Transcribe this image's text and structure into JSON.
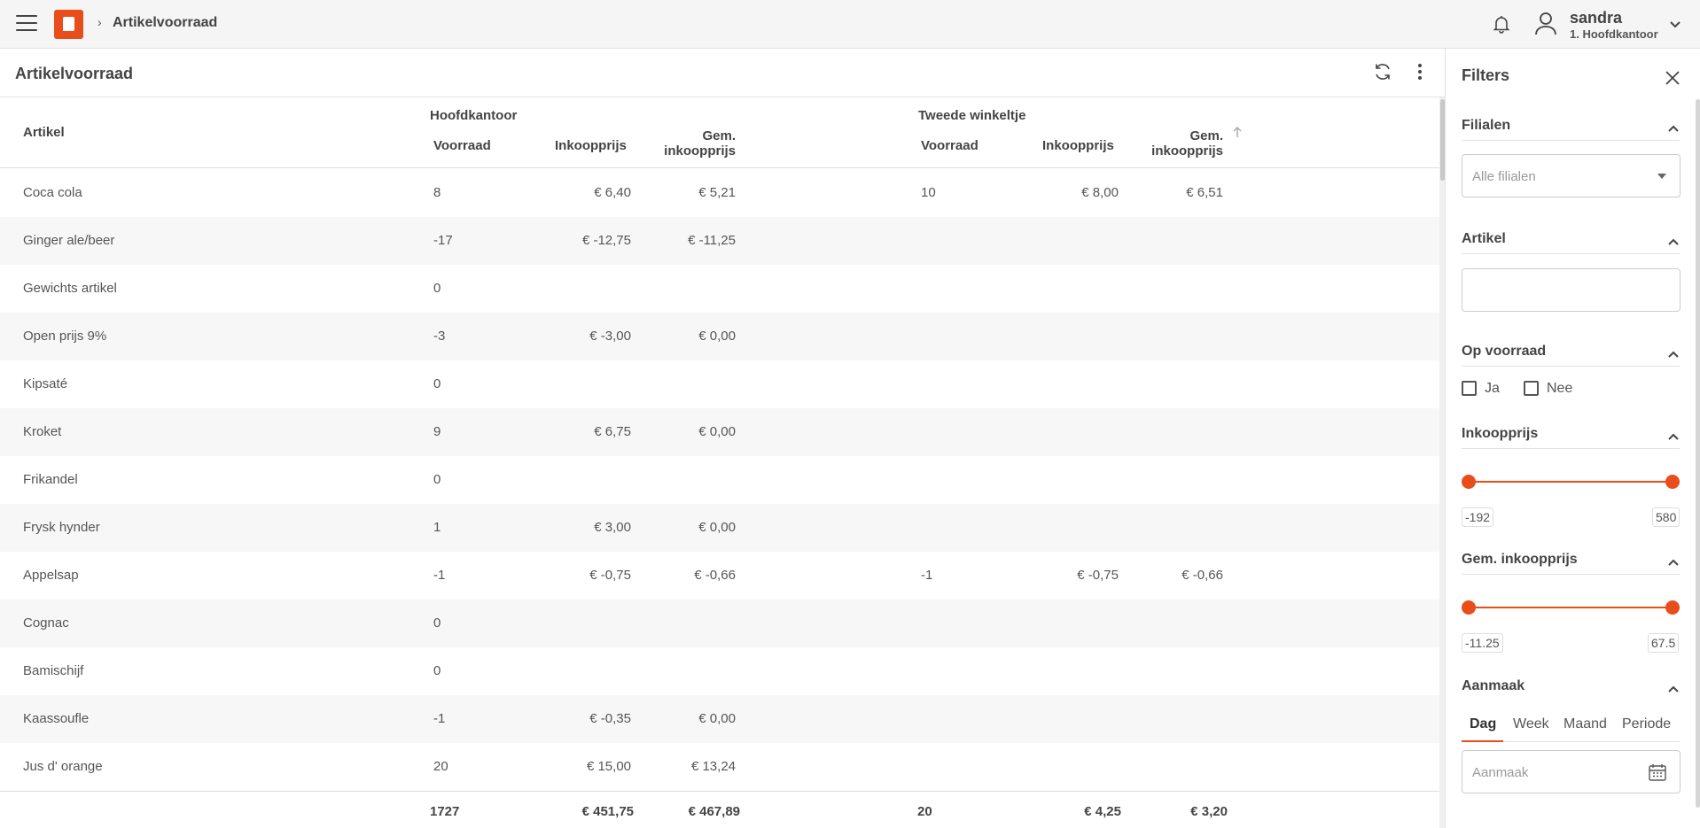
{
  "topbar": {
    "breadcrumb": "Artikelvoorraad",
    "user_name": "sandra",
    "user_branch": "1. Hoofdkantoor",
    "brand_color": "#e84e1b"
  },
  "panel": {
    "title": "Artikelvoorraad"
  },
  "table": {
    "col_artikel": "Artikel",
    "group1": "Hoofdkantoor",
    "group2": "Tweede winkeltje",
    "col_voorraad": "Voorraad",
    "col_inkoopprijs": "Inkoopprijs",
    "col_gem_line1": "Gem.",
    "col_gem_line2": "inkoopprijs",
    "rows": [
      {
        "artikel": "Coca cola",
        "v1": "8",
        "i1": "€ 6,40",
        "g1": "€ 5,21",
        "v2": "10",
        "i2": "€ 8,00",
        "g2": "€ 6,51"
      },
      {
        "artikel": "Ginger ale/beer",
        "v1": "-17",
        "i1": "€ -12,75",
        "g1": "€ -11,25",
        "v2": "",
        "i2": "",
        "g2": ""
      },
      {
        "artikel": "Gewichts artikel",
        "v1": "0",
        "i1": "",
        "g1": "",
        "v2": "",
        "i2": "",
        "g2": ""
      },
      {
        "artikel": "Open prijs 9%",
        "v1": "-3",
        "i1": "€ -3,00",
        "g1": "€ 0,00",
        "v2": "",
        "i2": "",
        "g2": ""
      },
      {
        "artikel": "Kipsaté",
        "v1": "0",
        "i1": "",
        "g1": "",
        "v2": "",
        "i2": "",
        "g2": ""
      },
      {
        "artikel": "Kroket",
        "v1": "9",
        "i1": "€ 6,75",
        "g1": "€ 0,00",
        "v2": "",
        "i2": "",
        "g2": ""
      },
      {
        "artikel": "Frikandel",
        "v1": "0",
        "i1": "",
        "g1": "",
        "v2": "",
        "i2": "",
        "g2": ""
      },
      {
        "artikel": "Frysk hynder",
        "v1": "1",
        "i1": "€ 3,00",
        "g1": "€ 0,00",
        "v2": "",
        "i2": "",
        "g2": ""
      },
      {
        "artikel": "Appelsap",
        "v1": "-1",
        "i1": "€ -0,75",
        "g1": "€ -0,66",
        "v2": "-1",
        "i2": "€ -0,75",
        "g2": "€ -0,66"
      },
      {
        "artikel": "Cognac",
        "v1": "0",
        "i1": "",
        "g1": "",
        "v2": "",
        "i2": "",
        "g2": ""
      },
      {
        "artikel": "Bamischijf",
        "v1": "0",
        "i1": "",
        "g1": "",
        "v2": "",
        "i2": "",
        "g2": ""
      },
      {
        "artikel": "Kaassoufle",
        "v1": "-1",
        "i1": "€ -0,35",
        "g1": "€ 0,00",
        "v2": "",
        "i2": "",
        "g2": ""
      },
      {
        "artikel": "Jus d' orange",
        "v1": "20",
        "i1": "€ 15,00",
        "g1": "€ 13,24",
        "v2": "",
        "i2": "",
        "g2": ""
      }
    ],
    "totals": {
      "v1": "1727",
      "i1": "€ 451,75",
      "g1": "€ 467,89",
      "v2": "20",
      "i2": "€ 4,25",
      "g2": "€ 3,20"
    }
  },
  "filters": {
    "title": "Filters",
    "filialen": {
      "title": "Filialen",
      "placeholder": "Alle filialen"
    },
    "artikel": {
      "title": "Artikel",
      "value": ""
    },
    "op_voorraad": {
      "title": "Op voorraad",
      "ja": "Ja",
      "nee": "Nee",
      "ja_checked": false,
      "nee_checked": false
    },
    "inkoopprijs": {
      "title": "Inkoopprijs",
      "min": "-192",
      "max": "580"
    },
    "gem_inkoopprijs": {
      "title": "Gem. inkoopprijs",
      "min": "-11.25",
      "max": "67.5"
    },
    "aanmaak": {
      "title": "Aanmaak",
      "tabs": [
        "Dag",
        "Week",
        "Maand",
        "Periode"
      ],
      "active_tab": "Dag",
      "placeholder": "Aanmaak"
    }
  }
}
